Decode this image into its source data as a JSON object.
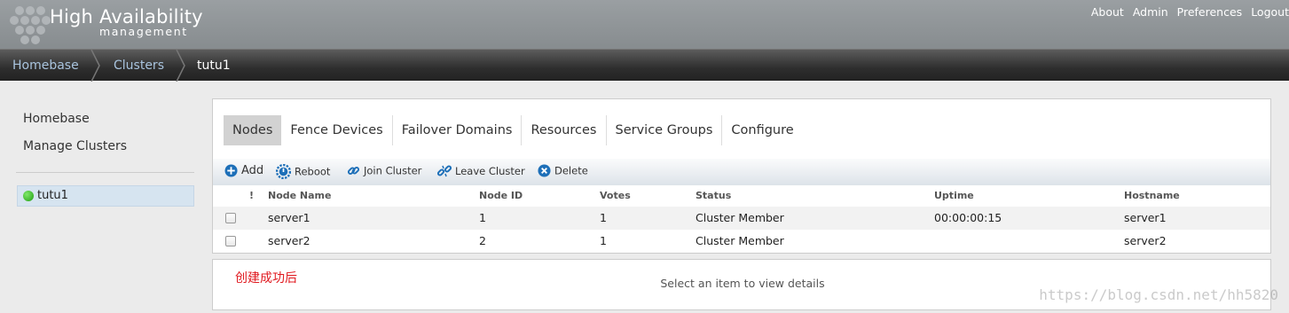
{
  "header": {
    "brand_title": "High Availability",
    "brand_subtitle": "management",
    "links": [
      "About",
      "Admin",
      "Preferences",
      "Logout"
    ]
  },
  "breadcrumb": [
    "Homebase",
    "Clusters",
    "tutu1"
  ],
  "sidebar": {
    "links": [
      "Homebase",
      "Manage Clusters"
    ],
    "clusters": [
      {
        "name": "tutu1",
        "status": "online",
        "status_color": "#2fb81f"
      }
    ]
  },
  "tabs": {
    "items": [
      "Nodes",
      "Fence Devices",
      "Failover Domains",
      "Resources",
      "Service Groups",
      "Configure"
    ],
    "active": "Nodes"
  },
  "toolbar": {
    "add": "Add",
    "reboot": "Reboot",
    "join": "Join Cluster",
    "leave": "Leave Cluster",
    "delete": "Delete"
  },
  "table": {
    "columns": [
      "!",
      "Node Name",
      "Node ID",
      "Votes",
      "Status",
      "Uptime",
      "Hostname"
    ],
    "rows": [
      {
        "name": "server1",
        "id": "1",
        "votes": "1",
        "status": "Cluster Member",
        "uptime": "00:00:00:15",
        "hostname": "server1"
      },
      {
        "name": "server2",
        "id": "2",
        "votes": "1",
        "status": "Cluster Member",
        "uptime": "",
        "hostname": "server2"
      }
    ]
  },
  "details": {
    "annotation": "创建成功后",
    "empty_message": "Select an item to view details"
  },
  "watermark": "https://blog.csdn.net/hh5820",
  "colors": {
    "accent_link": "#a9c4de",
    "selected_cluster_bg": "#d6e4f0",
    "toolbar_icon_blue": "#1d6fb8",
    "annotation_red": "#e0191f"
  }
}
